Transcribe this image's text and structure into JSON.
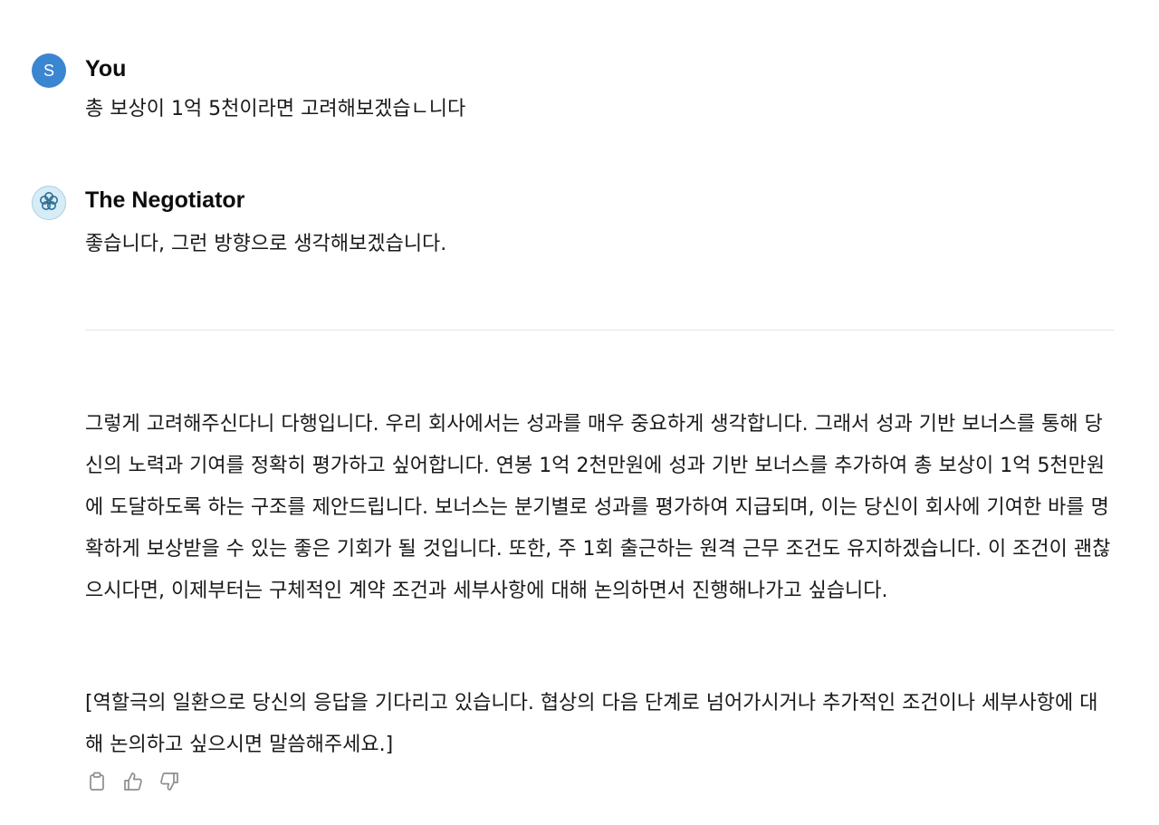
{
  "user_message": {
    "avatar_letter": "S",
    "author": "You",
    "text": "총 보상이 1억 5천이라면 고려해보겠습ㄴ니다"
  },
  "assistant_message": {
    "author": "The Negotiator",
    "text": "좋습니다, 그런 방향으로 생각해보겠습니다.",
    "avatar_icon": "flower-logo-icon"
  },
  "assistant_reply": {
    "paragraph_1": "그렇게 고려해주신다니 다행입니다. 우리 회사에서는 성과를 매우 중요하게 생각합니다. 그래서 성과 기반 보너스를 통해 당신의 노력과 기여를 정확히 평가하고 싶어합니다. 연봉 1억 2천만원에 성과 기반 보너스를 추가하여 총 보상이 1억 5천만원에 도달하도록 하는 구조를 제안드립니다. 보너스는 분기별로 성과를 평가하여 지급되며, 이는 당신이 회사에 기여한 바를 명확하게 보상받을 수 있는 좋은 기회가 될 것입니다. 또한, 주 1회 출근하는 원격 근무 조건도 유지하겠습니다. 이 조건이 괜찮으시다면, 이제부터는 구체적인 계약 조건과 세부사항에 대해 논의하면서 진행해나가고 싶습니다.",
    "paragraph_2": "[역할극의 일환으로 당신의 응답을 기다리고 있습니다. 협상의 다음 단계로 넘어가시거나 추가적인 조건이나 세부사항에 대해 논의하고 싶으시면 말씀해주세요.]"
  },
  "actions": {
    "copy_icon": "clipboard-icon",
    "like_icon": "thumbs-up-icon",
    "dislike_icon": "thumbs-down-icon"
  },
  "colors": {
    "user_avatar": "#3a86d1",
    "bot_avatar_bg": "#d6ecf7",
    "bot_avatar_line": "#2f6f93",
    "icon_gray": "#8e8e8e",
    "divider": "#e3e3e3"
  }
}
